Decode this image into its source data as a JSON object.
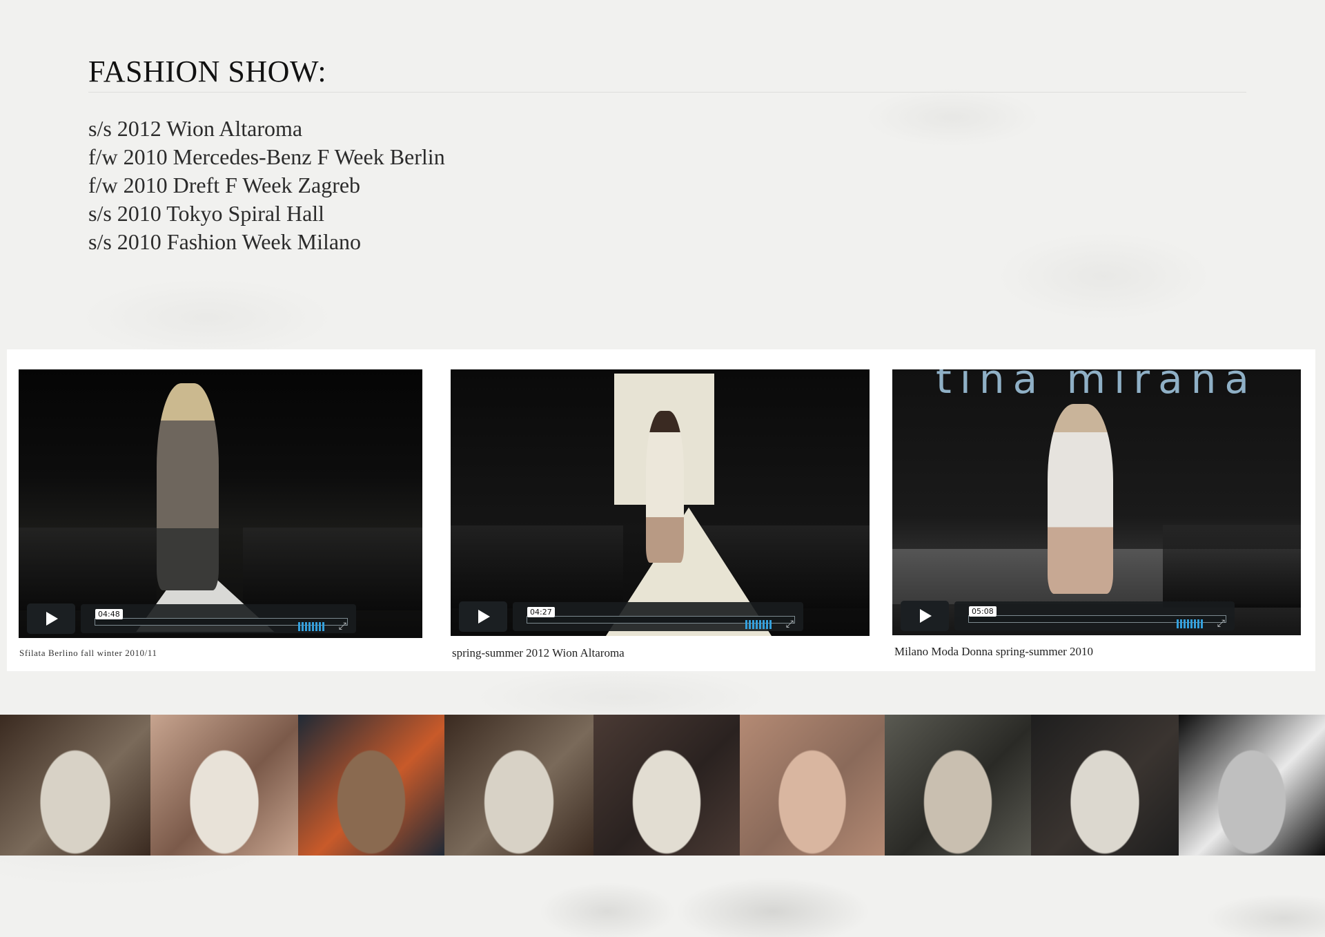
{
  "page": {
    "title": "FASHION SHOW:",
    "shows": [
      "s/s 2012 Wion Altaroma",
      "f/w 2010 Mercedes-Benz F Week Berlin",
      "f/w 2010 Dreft F Week Zagreb",
      "s/s 2010 Tokyo Spiral Hall",
      "s/s 2010 Fashion Week Milano"
    ]
  },
  "videos": [
    {
      "time": "04:48",
      "caption": "Sfilata Berlino fall winter 2010/11"
    },
    {
      "time": "04:27",
      "caption": "spring-summer 2012 Wion Altaroma"
    },
    {
      "time": "05:08",
      "caption": "Milano Moda Donna spring-summer 2010",
      "backdrop_text": "tina mirana"
    }
  ],
  "icons": {
    "play": "play-icon",
    "volume": "volume-icon",
    "fullscreen": "fullscreen-icon",
    "fullscreen_glyph": "⤢"
  },
  "thumbnails": [
    {
      "name": "backstage-white-coats",
      "colors": [
        "#3a2a20",
        "#d8d2c6",
        "#7a6a5a"
      ]
    },
    {
      "name": "white-top-detail",
      "colors": [
        "#c7a48f",
        "#e8e2d8",
        "#7b5a4a"
      ]
    },
    {
      "name": "makeup-brushes",
      "colors": [
        "#202a36",
        "#8a6a50",
        "#c85a2a"
      ]
    },
    {
      "name": "backstage-white-coats-2",
      "colors": [
        "#3a2a20",
        "#d8d2c6",
        "#7a6a5a"
      ]
    },
    {
      "name": "model-arms-crossed",
      "colors": [
        "#4a3a34",
        "#e2ddd2",
        "#2a2220"
      ]
    },
    {
      "name": "beige-jacket-back",
      "colors": [
        "#b48a74",
        "#d9b6a0",
        "#8a6a5a"
      ]
    },
    {
      "name": "makeup-table",
      "colors": [
        "#5a5a52",
        "#c9bfb0",
        "#2a2a26"
      ]
    },
    {
      "name": "clothing-rack",
      "colors": [
        "#1e1e1e",
        "#dcd8cf",
        "#3a3430"
      ]
    },
    {
      "name": "runway-models",
      "colors": [
        "#0c0c0c",
        "#bfbfbf",
        "#e9e9e9"
      ]
    }
  ]
}
